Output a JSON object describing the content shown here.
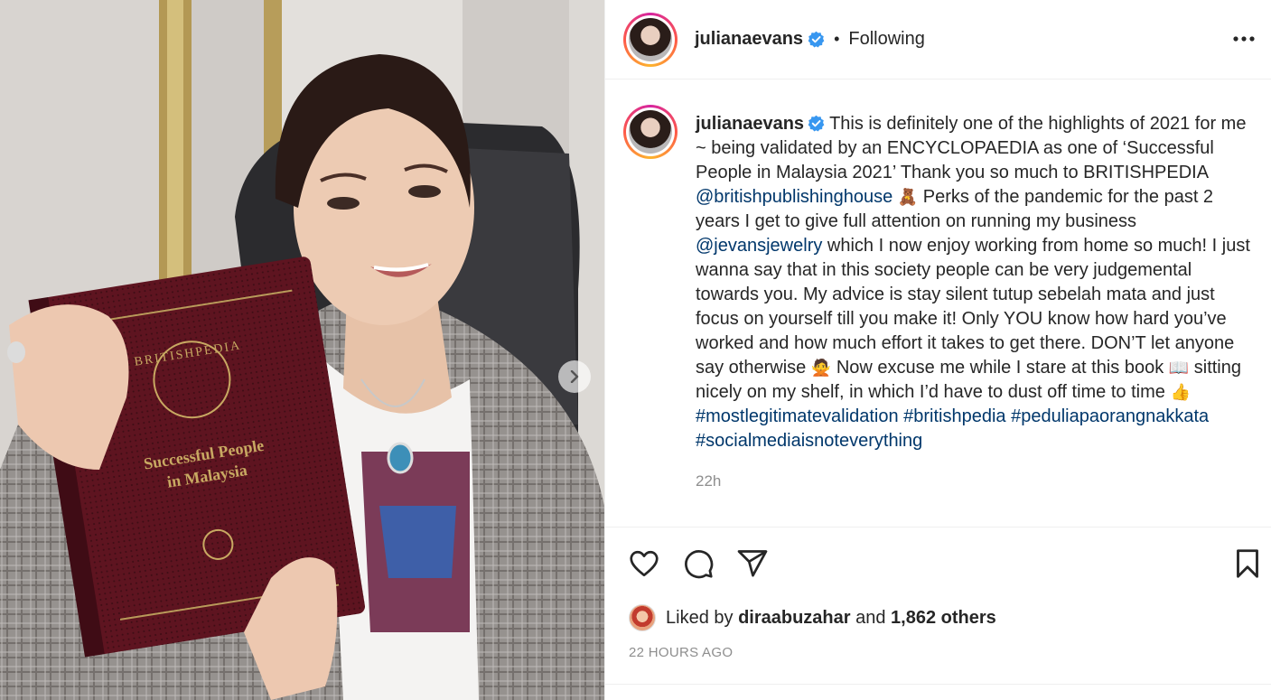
{
  "post": {
    "username": "julianaevans",
    "separator": "•",
    "follow_status": "Following",
    "more_icon": "more-horizontal-icon",
    "verified_color": "#3897f0"
  },
  "media": {
    "book_title_line1": "Successful People",
    "book_title_line2": "in Malaysia",
    "book_brand": "BRITISHPEDIA",
    "next_icon": "chevron-right-icon"
  },
  "caption": {
    "username": "julianaevans",
    "seg1": "This is definitely one of the highlights of 2021 for me ~ being validated by an ENCYCLOPAEDIA as one of ‘Successful People in Malaysia 2021’ Thank you so much to BRITISHPEDIA ",
    "mention1": "@britishpublishinghouse",
    "emoji1": "🧸",
    "seg2": " Perks of the pandemic for the past 2 years I get to give full attention on running my business ",
    "mention2": "@jevansjewelry",
    "seg3": " which I now enjoy working from home so much! I just wanna say that in this society people can be very judgemental towards you. My advice is stay silent tutup sebelah mata and just focus on yourself till you make it! Only YOU know how hard you’ve worked and how much effort it takes to get there. DON’T let anyone say otherwise ",
    "emoji2": "🙅",
    "seg4": " Now excuse me while I stare at this book ",
    "emoji3": "📖",
    "seg5": " sitting nicely on my shelf, in which I’d have to dust off time to time ",
    "emoji4": "👍",
    "hashtag1": "#mostlegitimatevalidation",
    "hashtag2": "#britishpedia",
    "hashtag3": "#peduliapaorangnakkata",
    "hashtag4": "#socialmediaisnoteverything",
    "time": "22h"
  },
  "actions": {
    "like_icon": "heart-icon",
    "comment_icon": "comment-icon",
    "share_icon": "send-icon",
    "save_icon": "bookmark-icon"
  },
  "likes": {
    "prefix": "Liked by",
    "user": "diraabuzahar",
    "and": "and",
    "others": "1,862 others"
  },
  "timestamp": "22 HOURS AGO",
  "colors": {
    "link": "#00376b",
    "muted": "#8e8e8e",
    "border": "#efefef",
    "book": "#5e1420"
  }
}
